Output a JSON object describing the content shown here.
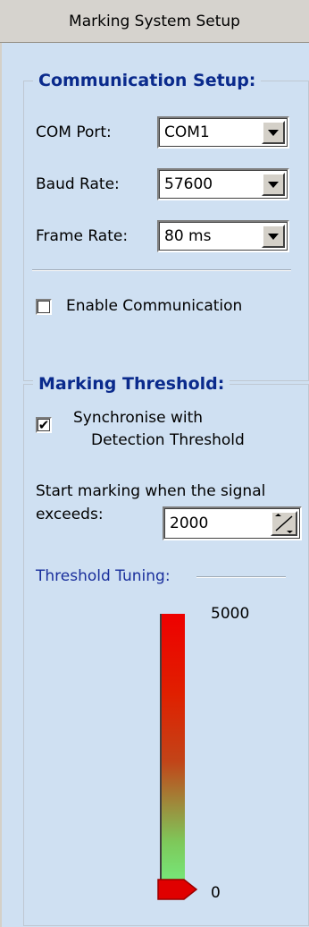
{
  "title": "Marking System Setup",
  "communication": {
    "group_title": "Communication Setup:",
    "com_port_label": "COM Port:",
    "com_port_value": "COM1",
    "baud_rate_label": "Baud Rate:",
    "baud_rate_value": "57600",
    "frame_rate_label": "Frame Rate:",
    "frame_rate_value": "80 ms",
    "enable_label": "Enable Communication",
    "enable_checked": false
  },
  "marking": {
    "group_title": "Marking Threshold:",
    "sync_label_line1": "Synchronise with",
    "sync_label_line2": "Detection Threshold",
    "sync_checked": true,
    "start_label_line1": "Start marking when the signal",
    "start_label_line2": "exceeds:",
    "threshold_value": "2000",
    "tuning_label": "Threshold Tuning:",
    "scale_max": "5000",
    "scale_min": "0",
    "slider_value": 0
  },
  "colors": {
    "panel": "#cfe0f2",
    "group_title": "#0a2a8c",
    "tuning_label": "#1a2f9c"
  }
}
